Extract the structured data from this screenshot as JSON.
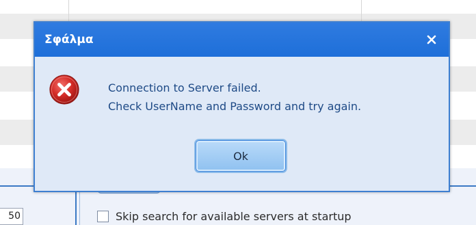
{
  "dialog": {
    "title": "Σφάλμα",
    "message_line1": "Connection to Server failed.",
    "message_line2": "Check UserName and Password and try again.",
    "ok_label": "Ok",
    "close_icon": "close-icon",
    "status_icon": "error-icon"
  },
  "background": {
    "field_value": "50",
    "skip_search_label": "Skip search for available servers at startup",
    "skip_search_checked": false
  },
  "colors": {
    "titlebar": "#2878de",
    "dialog_body": "#dfe9f7",
    "message_text": "#1e4a86",
    "error_red": "#d02a2a",
    "ok_button": "#a6cdf5"
  }
}
